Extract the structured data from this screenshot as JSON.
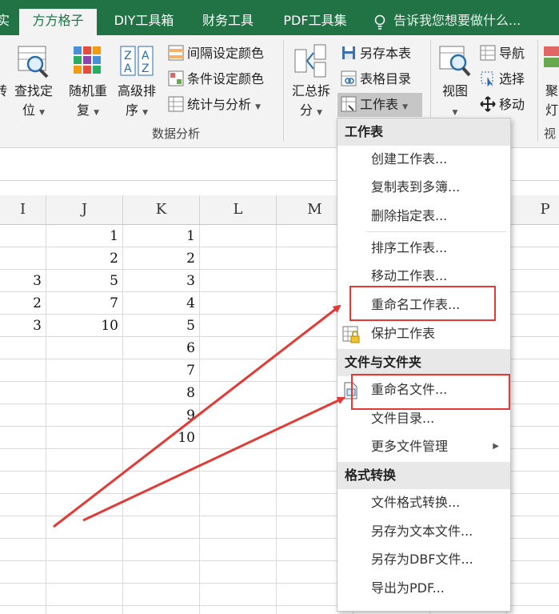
{
  "tabs": [
    {
      "label": "实"
    },
    {
      "label": "方方格子",
      "active": true
    },
    {
      "label": "DIY工具箱"
    },
    {
      "label": "财务工具"
    },
    {
      "label": "PDF工具集"
    }
  ],
  "tellme": {
    "placeholder": "告诉我您想要做什么..."
  },
  "ribbon": {
    "partial_left": {
      "top": "转"
    },
    "find_locate": {
      "line1": "查找定",
      "line2": "位"
    },
    "random_repeat": {
      "line1": "随机重",
      "line2": "复"
    },
    "advanced_sort": {
      "line1": "高级排",
      "line2": "序"
    },
    "interval_color": "间隔设定颜色",
    "condition_color": "条件设定颜色",
    "stats_analysis": "统计与分析",
    "group_data_analysis": "数据分析",
    "summary_split": {
      "line1": "汇总拆",
      "line2": "分"
    },
    "save_sheet": "另存本表",
    "table_directory": "表格目录",
    "worksheet": "工作表",
    "view": "视图",
    "navigation": "导航",
    "select": "选择",
    "move": "移动",
    "partial_right": {
      "line1": "聚",
      "line2": "灯"
    },
    "group_partial_right": "视"
  },
  "columns": [
    "I",
    "J",
    "K",
    "L",
    "M",
    "P"
  ],
  "cells": {
    "I": [
      "",
      "3",
      "2",
      "3"
    ],
    "J": [
      "1",
      "2",
      "5",
      "7",
      "10"
    ],
    "K": [
      "1",
      "2",
      "3",
      "4",
      "5",
      "6",
      "7",
      "8",
      "9",
      "10"
    ]
  },
  "menu": {
    "section_sheet": "工作表",
    "create_sheet": "创建工作表...",
    "copy_to_books": "复制表到多簿...",
    "delete_sheets": "删除指定表...",
    "sort_sheets": "排序工作表...",
    "move_sheets": "移动工作表...",
    "rename_sheets": "重命名工作表...",
    "protect_sheets": "保护工作表",
    "section_files": "文件与文件夹",
    "rename_files": "重命名文件...",
    "file_directory": "文件目录...",
    "more_file_mgmt": "更多文件管理",
    "section_convert": "格式转换",
    "file_format_convert": "文件格式转换...",
    "save_as_text": "另存为文本文件...",
    "save_as_dbf": "另存为DBF文件...",
    "export_pdf": "导出为PDF..."
  },
  "colors": {
    "ribbon_green": "#217346",
    "highlight_red": "#e53935",
    "arrow_red": "#e53935"
  }
}
